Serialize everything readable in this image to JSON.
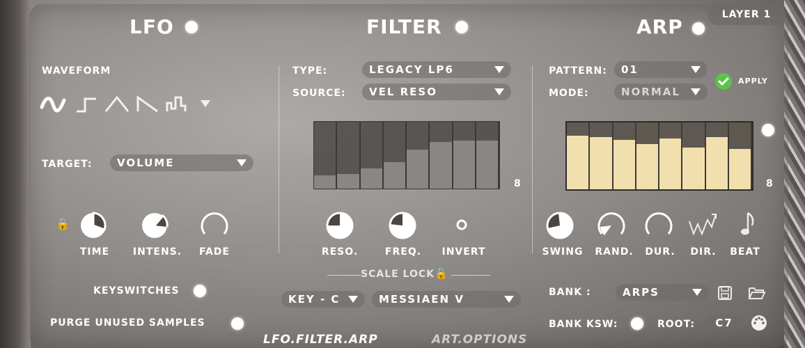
{
  "layer": "LAYER 1",
  "lfo": {
    "title": "LFO",
    "waveform_label": "WAVEFORM",
    "target_label": "TARGET:",
    "target_value": "VOLUME",
    "knobs": [
      "TIME",
      "INTENS.",
      "FADE"
    ]
  },
  "filter": {
    "title": "FILTER",
    "type_label": "TYPE:",
    "type_value": "LEGACY LP6",
    "source_label": "SOURCE:",
    "source_value": "VEL RESO",
    "steps_count": "8",
    "steps": [
      0.2,
      0.22,
      0.3,
      0.4,
      0.58,
      0.7,
      0.72,
      0.72
    ],
    "knobs": [
      "RESO.",
      "FREQ.",
      "INVERT"
    ]
  },
  "scale": {
    "label": "SCALE LOCK",
    "key_value": "KEY - C",
    "scale_value": "MESSIAEN V"
  },
  "arp": {
    "title": "ARP",
    "pattern_label": "PATTERN:",
    "pattern_value": "01",
    "mode_label": "MODE:",
    "mode_value": "NORMAL",
    "apply_label": "APPLY",
    "steps_count": "8",
    "steps": [
      0.8,
      0.78,
      0.74,
      0.68,
      0.76,
      0.62,
      0.78,
      0.6
    ],
    "knobs": [
      "SWING",
      "RAND.",
      "DUR.",
      "DIR.",
      "BEAT"
    ],
    "bank_label": "BANK :",
    "bank_value": "ARPS",
    "bank_ksw_label": "BANK KSW:",
    "root_label": "ROOT:",
    "root_value": "C7"
  },
  "options": {
    "keyswitches": "KEYSWITCHES",
    "purge": "PURGE UNUSED SAMPLES"
  },
  "tabs": [
    "LFO.FILTER.ARP",
    "ART.OPTIONS"
  ],
  "colors": {
    "step_fill": "#f1e0ae",
    "apply_check": "#5cc24a",
    "filter_step": "#8a8684"
  }
}
